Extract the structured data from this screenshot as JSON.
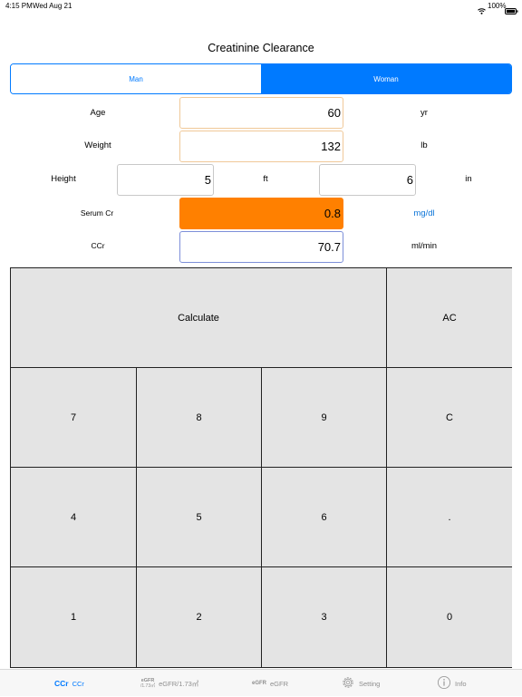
{
  "status": {
    "time": "4:15 PM",
    "date": "Wed Aug 21",
    "battery": "100%"
  },
  "title": "Creatinine Clearance",
  "gender": {
    "man": "Man",
    "woman": "Woman"
  },
  "rows": {
    "age": {
      "label": "Age",
      "value": "60",
      "unit": "yr"
    },
    "weight": {
      "label": "Weight",
      "value": "132",
      "unit": "lb"
    },
    "height": {
      "label": "Height",
      "feet": "5",
      "feet_unit": "ft",
      "inches": "6",
      "inch_unit": "in"
    },
    "serum": {
      "label": "Serum Cr",
      "value": "0.8",
      "unit": "mg/dl"
    },
    "ccr": {
      "label": "CCr",
      "value": "70.7",
      "unit": "ml/min"
    }
  },
  "keypad": {
    "calculate": "Calculate",
    "ac": "AC",
    "k7": "7",
    "k8": "8",
    "k9": "9",
    "c": "C",
    "k4": "4",
    "k5": "5",
    "k6": "6",
    "dot": ".",
    "k1": "1",
    "k2": "2",
    "k3": "3",
    "k0": "0"
  },
  "tabs": {
    "ccr_icon": "CCr",
    "ccr": "CCr",
    "egfr173_icon_top": "eGFR",
    "egfr173_icon_bottom": "/1.73㎡",
    "egfr173": "eGFR/1.73㎡",
    "egfr_icon": "eGFR",
    "egfr": "eGFR",
    "setting": "Setting",
    "info": "Info"
  },
  "colors": {
    "accent": "#007aff",
    "highlight": "#ff8000",
    "pad": "#e4e4e4"
  },
  "icons": [
    "wifi-icon",
    "battery-icon",
    "gear-icon",
    "info-icon"
  ]
}
